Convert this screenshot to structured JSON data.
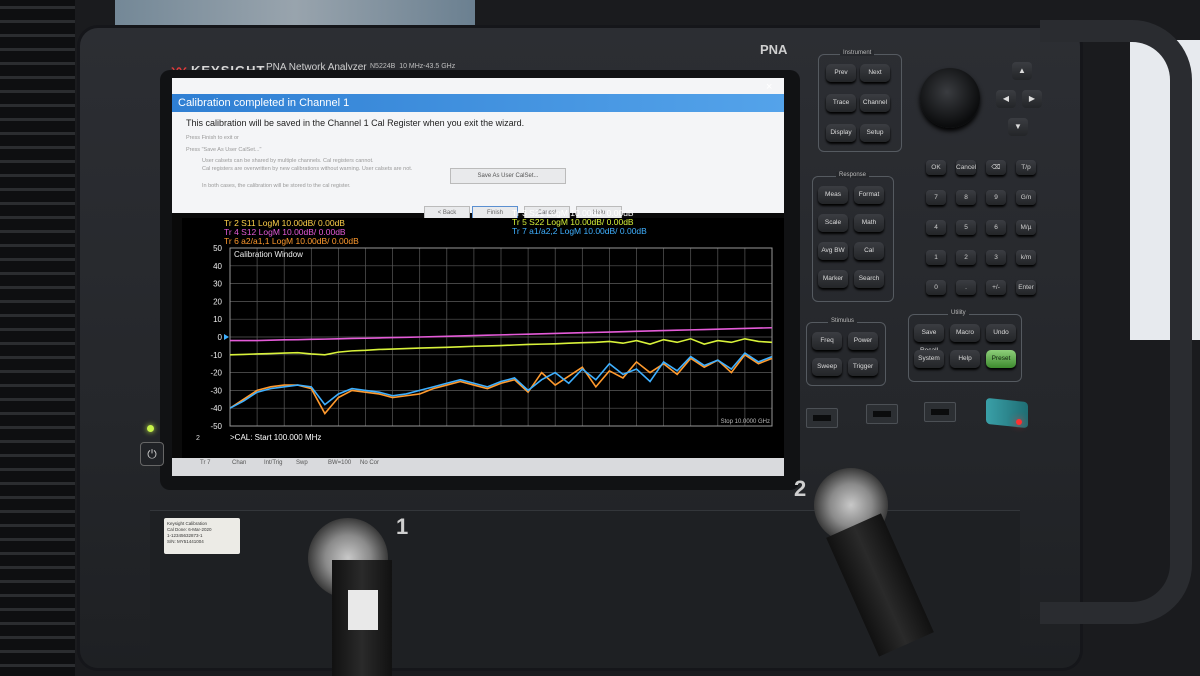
{
  "instrument": {
    "brand": "KEYSIGHT",
    "model": "PNA Network Analyzer",
    "model_number": "N5224B",
    "frequency_range": "10 MHz-43.5 GHz",
    "series": "PNA"
  },
  "dialog": {
    "title": "Calibration completed in Channel 1",
    "close": "×",
    "message": "This calibration will be saved in the Channel 1 Cal Register when you exit the wizard.",
    "hint_finish": "Press Finish to exit or",
    "hint_save": "Press \"Save As User CalSet...\"",
    "info_line1": "User calsets can be shared by multiple channels. Cal registers cannot.",
    "info_line2": "Cal registers are overwritten by new calibrations without warning. User calsets are not.",
    "info_line3": "In both cases, the calibration will be stored to the cal register.",
    "save_as_user_calset": "Save As User CalSet...",
    "back": "< Back",
    "finish": "Finish",
    "cancel": "Cancel",
    "help": "Help"
  },
  "plot": {
    "window_title": "Calibration Window",
    "traces": [
      {
        "id": "Tr 2",
        "label": "S11 LogM 10.00dB/  0.00dB",
        "color": "#ffd24a"
      },
      {
        "id": "Tr 4",
        "label": "S12 LogM 10.00dB/  0.00dB",
        "color": "#e45bd8"
      },
      {
        "id": "Tr 6",
        "label": "a2/a1,1 LogM 10.00dB/  0.00dB",
        "color": "#ff9a2e"
      },
      {
        "id": "Tr 3",
        "label": "S21 LogM 10.00dB/  0.00dB",
        "color": "#ffffff"
      },
      {
        "id": "Tr 5",
        "label": "S22 LogM 10.00dB/  0.00dB",
        "color": "#d8f23a"
      },
      {
        "id": "Tr 7",
        "label": "a1/a2,2 LogM 10.00dB/  0.00dB",
        "color": "#3fb0ff"
      }
    ],
    "y_ticks": [
      "50",
      "40",
      "30",
      "20",
      "10",
      "0",
      "-10",
      "-20",
      "-30",
      "-40",
      "-50"
    ],
    "start_label": ">CAL:  Start  100.000 MHz",
    "stop_label": "Stop  10.0000 GHz",
    "marker_reference": "2"
  },
  "status_tabs": [
    "Tr 7",
    "Chan",
    "Int/Trig",
    "Swp",
    "BW=100",
    "No Cor"
  ],
  "keypad": {
    "instrument_header": "Instrument",
    "instrument_keys": [
      "Prev",
      "Next",
      "Trace",
      "Channel",
      "Display",
      "Setup"
    ],
    "response_header": "Response",
    "response_keys": [
      "Meas",
      "Format",
      "Scale",
      "Math",
      "Avg BW",
      "Cal",
      "Marker",
      "Search"
    ],
    "stimulus_header": "Stimulus",
    "stimulus_keys": [
      "Freq",
      "Power",
      "Sweep",
      "Trigger"
    ],
    "utility_header": "Utility",
    "utility_keys": [
      "Save Recall",
      "Macro",
      "Undo",
      "System",
      "Help",
      "Preset"
    ],
    "entry_keys": [
      "OK",
      "Cancel",
      "⌫",
      "T/p",
      "7",
      "8",
      "9",
      "G/n",
      "4",
      "5",
      "6",
      "M/µ",
      "1",
      "2",
      "3",
      "k/m",
      "0",
      ".",
      "+/-",
      "Enter"
    ],
    "arrows": [
      "▲",
      "◀",
      "▶",
      "▼"
    ]
  },
  "front_panel": {
    "power_icon": "⏻",
    "port1": "1",
    "port2": "2",
    "cal_sticker": {
      "title": "Keysight Calibration",
      "cal_done": "Cal Done:  6-Mar-2020",
      "id": "1-12345632873-1",
      "serial": "S/N: MY51441004"
    }
  },
  "colors": {
    "s11": "#ffd24a",
    "s12": "#e45bd8",
    "a2a1": "#ff9a2e",
    "s21": "#ffffff",
    "s22": "#d8f23a",
    "a1a2": "#3fb0ff",
    "title_bar": "#2f7fd3",
    "preset": "#5fb84a"
  },
  "chart_data": {
    "type": "line",
    "title": "Calibration Window",
    "xlabel": "",
    "ylabel": "",
    "ylim": [
      -50,
      50
    ],
    "x_range_label": [
      ">CAL:  Start  100.000 MHz",
      "Stop  10.0000 GHz"
    ],
    "x": [
      0,
      1,
      2,
      3,
      4,
      5,
      6,
      7,
      8,
      9,
      10,
      11,
      12,
      13,
      14,
      15,
      16,
      17,
      18,
      19,
      20,
      21,
      22,
      23,
      24,
      25,
      26,
      27,
      28,
      29,
      30,
      31,
      32,
      33,
      34,
      35,
      36,
      37,
      38,
      39,
      40
    ],
    "series": [
      {
        "name": "S12",
        "color": "#e45bd8",
        "values": [
          -2,
          -2,
          -2,
          -1.8,
          -1.6,
          -1.5,
          -1.3,
          -1.2,
          -1,
          -0.8,
          -0.7,
          -0.5,
          -0.3,
          -0.2,
          0,
          0.2,
          0.4,
          0.6,
          0.8,
          1,
          1.2,
          1.4,
          1.6,
          1.8,
          2,
          2.2,
          2.4,
          2.6,
          2.8,
          3,
          3.2,
          3.4,
          3.6,
          3.8,
          4,
          4.2,
          4.4,
          4.6,
          4.8,
          5,
          5.2
        ]
      },
      {
        "name": "S22",
        "color": "#d8f23a",
        "values": [
          -10,
          -9.8,
          -9.5,
          -9.3,
          -9,
          -8.8,
          -9.5,
          -10,
          -8.5,
          -7.8,
          -7.5,
          -7,
          -6.8,
          -6.5,
          -6.2,
          -6,
          -5.8,
          -5.5,
          -5.2,
          -5,
          -4.8,
          -4.5,
          -4.2,
          -4,
          -3.8,
          -3.5,
          -3.2,
          -3,
          -2.5,
          -3.5,
          -2,
          -4,
          -1.5,
          -3,
          -1,
          -4,
          -2,
          -3,
          -1,
          -2.5,
          -3
        ]
      },
      {
        "name": "a2/a1,1",
        "color": "#ff9a2e",
        "values": [
          -40,
          -35,
          -30,
          -28,
          -27,
          -27,
          -29,
          -43,
          -34,
          -30,
          -31,
          -32,
          -34,
          -33,
          -32,
          -29,
          -27,
          -25,
          -27,
          -29,
          -26,
          -24,
          -31,
          -20,
          -27,
          -22,
          -17,
          -28,
          -19,
          -23,
          -14,
          -20,
          -15,
          -21,
          -12,
          -17,
          -13,
          -20,
          -10,
          -15,
          -12
        ]
      },
      {
        "name": "a1/a2,2",
        "color": "#3fb0ff",
        "values": [
          -40,
          -36,
          -31,
          -29,
          -28,
          -27,
          -28,
          -38,
          -32,
          -29,
          -30,
          -31,
          -33,
          -32,
          -30,
          -28,
          -26,
          -24,
          -26,
          -28,
          -25,
          -23,
          -30,
          -24,
          -20,
          -26,
          -18,
          -24,
          -15,
          -21,
          -18,
          -25,
          -14,
          -19,
          -11,
          -16,
          -13,
          -18,
          -9,
          -14,
          -11
        ]
      }
    ]
  }
}
